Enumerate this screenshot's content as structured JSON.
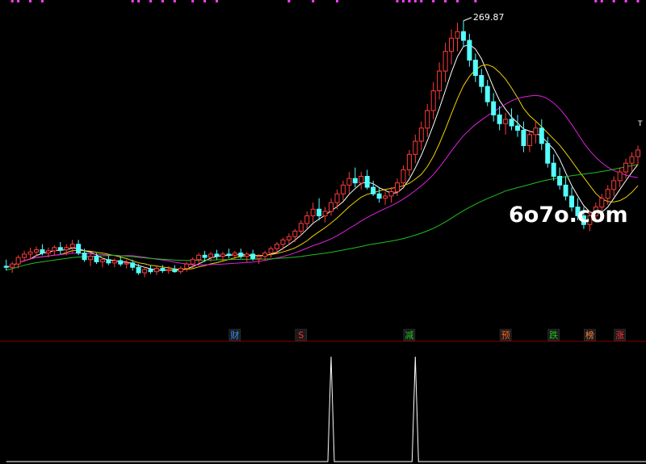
{
  "watermark": "6o7o.com",
  "colors": {
    "background": "#000000",
    "candle_up": "#ff3b3b",
    "candle_down": "#54ffff",
    "ma_white": "#ffffff",
    "ma_yellow": "#f0d000",
    "ma_magenta": "#e020e0",
    "ma_green": "#20c020",
    "separator": "#800000",
    "volume_line": "#ffffff",
    "top_ticks": "#ff40ff",
    "peak_label": "#ffffff"
  },
  "chart_data": [
    {
      "type": "candlestick",
      "title": "",
      "peak_label": "269.87",
      "corner_mark": "T",
      "ylim": [
        15,
        280
      ],
      "candles": [
        {
          "o": 46,
          "h": 52,
          "l": 42,
          "c": 45
        },
        {
          "o": 45,
          "h": 50,
          "l": 40,
          "c": 48
        },
        {
          "o": 48,
          "h": 56,
          "l": 44,
          "c": 54
        },
        {
          "o": 54,
          "h": 60,
          "l": 50,
          "c": 57
        },
        {
          "o": 57,
          "h": 63,
          "l": 52,
          "c": 59
        },
        {
          "o": 59,
          "h": 64,
          "l": 55,
          "c": 61
        },
        {
          "o": 61,
          "h": 66,
          "l": 56,
          "c": 58
        },
        {
          "o": 58,
          "h": 63,
          "l": 54,
          "c": 60
        },
        {
          "o": 60,
          "h": 65,
          "l": 56,
          "c": 63
        },
        {
          "o": 63,
          "h": 68,
          "l": 57,
          "c": 61
        },
        {
          "o": 61,
          "h": 66,
          "l": 56,
          "c": 63
        },
        {
          "o": 63,
          "h": 70,
          "l": 58,
          "c": 66
        },
        {
          "o": 66,
          "h": 70,
          "l": 56,
          "c": 58
        },
        {
          "o": 58,
          "h": 62,
          "l": 50,
          "c": 52
        },
        {
          "o": 52,
          "h": 58,
          "l": 46,
          "c": 55
        },
        {
          "o": 55,
          "h": 58,
          "l": 48,
          "c": 50
        },
        {
          "o": 50,
          "h": 54,
          "l": 45,
          "c": 52
        },
        {
          "o": 52,
          "h": 56,
          "l": 47,
          "c": 49
        },
        {
          "o": 49,
          "h": 53,
          "l": 45,
          "c": 51
        },
        {
          "o": 51,
          "h": 55,
          "l": 46,
          "c": 48
        },
        {
          "o": 48,
          "h": 52,
          "l": 44,
          "c": 49
        },
        {
          "o": 49,
          "h": 52,
          "l": 42,
          "c": 45
        },
        {
          "o": 45,
          "h": 48,
          "l": 38,
          "c": 40
        },
        {
          "o": 40,
          "h": 45,
          "l": 36,
          "c": 43
        },
        {
          "o": 43,
          "h": 47,
          "l": 39,
          "c": 41
        },
        {
          "o": 41,
          "h": 46,
          "l": 38,
          "c": 44
        },
        {
          "o": 44,
          "h": 47,
          "l": 40,
          "c": 42
        },
        {
          "o": 42,
          "h": 46,
          "l": 39,
          "c": 43
        },
        {
          "o": 43,
          "h": 47,
          "l": 40,
          "c": 41
        },
        {
          "o": 41,
          "h": 46,
          "l": 39,
          "c": 44
        },
        {
          "o": 44,
          "h": 50,
          "l": 41,
          "c": 48
        },
        {
          "o": 48,
          "h": 54,
          "l": 44,
          "c": 52
        },
        {
          "o": 52,
          "h": 58,
          "l": 48,
          "c": 56
        },
        {
          "o": 56,
          "h": 60,
          "l": 50,
          "c": 54
        },
        {
          "o": 54,
          "h": 59,
          "l": 50,
          "c": 57
        },
        {
          "o": 57,
          "h": 61,
          "l": 52,
          "c": 55
        },
        {
          "o": 55,
          "h": 59,
          "l": 51,
          "c": 57
        },
        {
          "o": 57,
          "h": 62,
          "l": 53,
          "c": 56
        },
        {
          "o": 56,
          "h": 60,
          "l": 52,
          "c": 58
        },
        {
          "o": 58,
          "h": 62,
          "l": 53,
          "c": 55
        },
        {
          "o": 55,
          "h": 59,
          "l": 50,
          "c": 57
        },
        {
          "o": 57,
          "h": 61,
          "l": 51,
          "c": 53
        },
        {
          "o": 53,
          "h": 57,
          "l": 48,
          "c": 55
        },
        {
          "o": 55,
          "h": 60,
          "l": 51,
          "c": 58
        },
        {
          "o": 58,
          "h": 64,
          "l": 54,
          "c": 62
        },
        {
          "o": 62,
          "h": 68,
          "l": 57,
          "c": 66
        },
        {
          "o": 66,
          "h": 72,
          "l": 61,
          "c": 70
        },
        {
          "o": 70,
          "h": 76,
          "l": 65,
          "c": 73
        },
        {
          "o": 73,
          "h": 80,
          "l": 68,
          "c": 78
        },
        {
          "o": 78,
          "h": 88,
          "l": 74,
          "c": 85
        },
        {
          "o": 85,
          "h": 96,
          "l": 80,
          "c": 92
        },
        {
          "o": 92,
          "h": 104,
          "l": 86,
          "c": 98
        },
        {
          "o": 98,
          "h": 108,
          "l": 88,
          "c": 92
        },
        {
          "o": 92,
          "h": 100,
          "l": 86,
          "c": 96
        },
        {
          "o": 96,
          "h": 108,
          "l": 92,
          "c": 104
        },
        {
          "o": 104,
          "h": 116,
          "l": 98,
          "c": 112
        },
        {
          "o": 112,
          "h": 124,
          "l": 106,
          "c": 120
        },
        {
          "o": 120,
          "h": 132,
          "l": 112,
          "c": 126
        },
        {
          "o": 126,
          "h": 136,
          "l": 118,
          "c": 122
        },
        {
          "o": 122,
          "h": 132,
          "l": 116,
          "c": 128
        },
        {
          "o": 128,
          "h": 134,
          "l": 116,
          "c": 118
        },
        {
          "o": 118,
          "h": 124,
          "l": 110,
          "c": 112
        },
        {
          "o": 112,
          "h": 118,
          "l": 104,
          "c": 108
        },
        {
          "o": 108,
          "h": 114,
          "l": 102,
          "c": 110
        },
        {
          "o": 110,
          "h": 118,
          "l": 104,
          "c": 114
        },
        {
          "o": 114,
          "h": 126,
          "l": 110,
          "c": 122
        },
        {
          "o": 122,
          "h": 138,
          "l": 118,
          "c": 134
        },
        {
          "o": 134,
          "h": 152,
          "l": 128,
          "c": 148
        },
        {
          "o": 148,
          "h": 166,
          "l": 140,
          "c": 160
        },
        {
          "o": 160,
          "h": 178,
          "l": 152,
          "c": 172
        },
        {
          "o": 172,
          "h": 194,
          "l": 164,
          "c": 188
        },
        {
          "o": 188,
          "h": 214,
          "l": 180,
          "c": 206
        },
        {
          "o": 206,
          "h": 232,
          "l": 198,
          "c": 224
        },
        {
          "o": 224,
          "h": 250,
          "l": 214,
          "c": 242
        },
        {
          "o": 242,
          "h": 262,
          "l": 230,
          "c": 254
        },
        {
          "o": 254,
          "h": 268,
          "l": 242,
          "c": 260
        },
        {
          "o": 260,
          "h": 269.87,
          "l": 246,
          "c": 252
        },
        {
          "o": 252,
          "h": 258,
          "l": 228,
          "c": 234
        },
        {
          "o": 234,
          "h": 240,
          "l": 214,
          "c": 220
        },
        {
          "o": 220,
          "h": 226,
          "l": 204,
          "c": 210
        },
        {
          "o": 210,
          "h": 216,
          "l": 192,
          "c": 196
        },
        {
          "o": 196,
          "h": 204,
          "l": 178,
          "c": 184
        },
        {
          "o": 184,
          "h": 192,
          "l": 170,
          "c": 176
        },
        {
          "o": 176,
          "h": 186,
          "l": 166,
          "c": 180
        },
        {
          "o": 180,
          "h": 190,
          "l": 170,
          "c": 174
        },
        {
          "o": 174,
          "h": 184,
          "l": 164,
          "c": 170
        },
        {
          "o": 170,
          "h": 178,
          "l": 150,
          "c": 156
        },
        {
          "o": 156,
          "h": 170,
          "l": 150,
          "c": 166
        },
        {
          "o": 166,
          "h": 178,
          "l": 158,
          "c": 172
        },
        {
          "o": 172,
          "h": 180,
          "l": 152,
          "c": 158
        },
        {
          "o": 158,
          "h": 164,
          "l": 136,
          "c": 140
        },
        {
          "o": 140,
          "h": 148,
          "l": 124,
          "c": 128
        },
        {
          "o": 128,
          "h": 136,
          "l": 116,
          "c": 120
        },
        {
          "o": 120,
          "h": 128,
          "l": 106,
          "c": 110
        },
        {
          "o": 110,
          "h": 118,
          "l": 96,
          "c": 100
        },
        {
          "o": 100,
          "h": 108,
          "l": 88,
          "c": 92
        },
        {
          "o": 92,
          "h": 100,
          "l": 80,
          "c": 84
        },
        {
          "o": 84,
          "h": 96,
          "l": 78,
          "c": 92
        },
        {
          "o": 92,
          "h": 104,
          "l": 86,
          "c": 100
        },
        {
          "o": 100,
          "h": 112,
          "l": 94,
          "c": 108
        },
        {
          "o": 108,
          "h": 120,
          "l": 102,
          "c": 116
        },
        {
          "o": 116,
          "h": 128,
          "l": 110,
          "c": 124
        },
        {
          "o": 124,
          "h": 136,
          "l": 118,
          "c": 132
        },
        {
          "o": 132,
          "h": 144,
          "l": 126,
          "c": 140
        },
        {
          "o": 140,
          "h": 150,
          "l": 132,
          "c": 146
        },
        {
          "o": 146,
          "h": 156,
          "l": 138,
          "c": 152
        }
      ],
      "moving_averages": [
        {
          "periods": 5,
          "color": "#ffffff"
        },
        {
          "periods": 10,
          "color": "#f0d000"
        },
        {
          "periods": 20,
          "color": "#e020e0"
        },
        {
          "periods": 60,
          "color": "#20c020"
        }
      ]
    },
    {
      "type": "line",
      "title": "",
      "ylim": [
        0,
        1
      ],
      "series": [
        {
          "values": [
            0,
            0,
            0,
            0,
            0,
            0,
            0,
            0,
            0,
            0,
            0,
            0,
            0,
            0,
            0,
            0,
            0,
            0,
            0,
            0,
            0,
            0,
            0,
            0,
            0,
            0,
            0,
            0,
            0,
            0,
            0,
            0,
            0,
            0,
            0,
            0,
            0,
            0,
            0,
            0,
            0,
            0,
            0,
            0,
            0,
            0,
            0,
            0,
            0,
            0,
            0,
            0,
            0,
            0,
            0,
            0,
            0,
            0,
            0,
            0,
            0,
            0,
            0,
            0,
            0,
            0,
            0,
            0,
            0,
            0,
            0,
            0,
            0,
            0,
            0,
            0,
            0,
            0,
            0,
            0,
            0,
            0,
            0,
            0,
            0,
            0,
            0,
            0,
            0,
            0,
            0,
            0,
            0,
            0,
            0,
            0,
            0,
            0,
            0,
            0,
            0,
            0,
            0,
            0,
            0,
            0,
            0,
            0
          ],
          "pulses": [
            {
              "index": 54,
              "value": 1
            },
            {
              "index": 68,
              "value": 1
            }
          ]
        }
      ]
    }
  ],
  "markers": [
    {
      "label": "财",
      "color": "#2f8fff",
      "candle_index": 38
    },
    {
      "label": "S",
      "color": "#ff3030",
      "candle_index": 49
    },
    {
      "label": "减",
      "color": "#20c020",
      "candle_index": 67
    },
    {
      "label": "预",
      "color": "#ff6020",
      "candle_index": 83
    },
    {
      "label": "跌",
      "color": "#20c020",
      "candle_index": 91
    },
    {
      "label": "榜",
      "color": "#ff8040",
      "candle_index": 97
    },
    {
      "label": "涨",
      "color": "#ff3030",
      "candle_index": 102
    }
  ]
}
